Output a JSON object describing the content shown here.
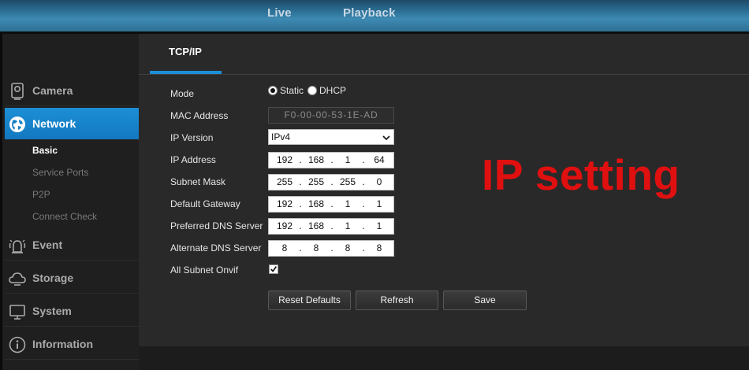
{
  "top_nav": {
    "live": "Live",
    "playback": "Playback"
  },
  "sidebar": {
    "items": [
      {
        "label": "Camera",
        "icon": "camera-icon"
      },
      {
        "label": "Network",
        "icon": "globe-icon",
        "active": true
      },
      {
        "label": "Event",
        "icon": "alarm-icon"
      },
      {
        "label": "Storage",
        "icon": "cloud-icon"
      },
      {
        "label": "System",
        "icon": "monitor-icon"
      },
      {
        "label": "Information",
        "icon": "info-icon"
      }
    ],
    "network_sub": [
      {
        "label": "Basic",
        "active": true
      },
      {
        "label": "Service Ports"
      },
      {
        "label": "P2P"
      },
      {
        "label": "Connect Check"
      }
    ]
  },
  "tab": {
    "label": "TCP/IP"
  },
  "form": {
    "mode": {
      "label": "Mode",
      "options": [
        "Static",
        "DHCP"
      ],
      "selected": "Static"
    },
    "mac": {
      "label": "MAC Address",
      "value": "F0-00-00-53-1E-AD"
    },
    "ip_version": {
      "label": "IP Version",
      "value": "IPv4"
    },
    "ip_address": {
      "label": "IP Address",
      "octets": [
        "192",
        "168",
        "1",
        "64"
      ]
    },
    "subnet_mask": {
      "label": "Subnet Mask",
      "octets": [
        "255",
        "255",
        "255",
        "0"
      ]
    },
    "gateway": {
      "label": "Default Gateway",
      "octets": [
        "192",
        "168",
        "1",
        "1"
      ]
    },
    "dns1": {
      "label": "Preferred DNS Server",
      "octets": [
        "192",
        "168",
        "1",
        "1"
      ]
    },
    "dns2": {
      "label": "Alternate DNS Server",
      "octets": [
        "8",
        "8",
        "8",
        "8"
      ]
    },
    "onvif": {
      "label": "All Subnet Onvif",
      "checked": true
    }
  },
  "buttons": {
    "reset": "Reset Defaults",
    "refresh": "Refresh",
    "save": "Save"
  },
  "overlay": {
    "text": "IP setting"
  },
  "colors": {
    "accent": "#1c8fd6",
    "overlay": "#e01010"
  }
}
